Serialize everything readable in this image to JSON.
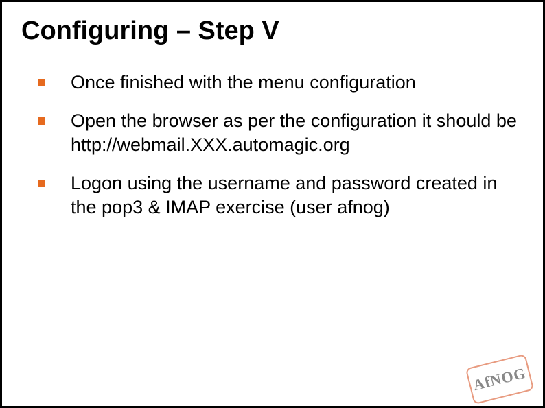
{
  "slide": {
    "title": "Configuring – Step V",
    "bullets": [
      "Once finished with the menu configuration",
      "Open the browser as per the configuration it should be http://webmail.XXX.automagic.org",
      "Logon using the username and password created in the pop3 & IMAP exercise (user afnog)"
    ]
  },
  "stamp": {
    "text": "AfNOG"
  }
}
